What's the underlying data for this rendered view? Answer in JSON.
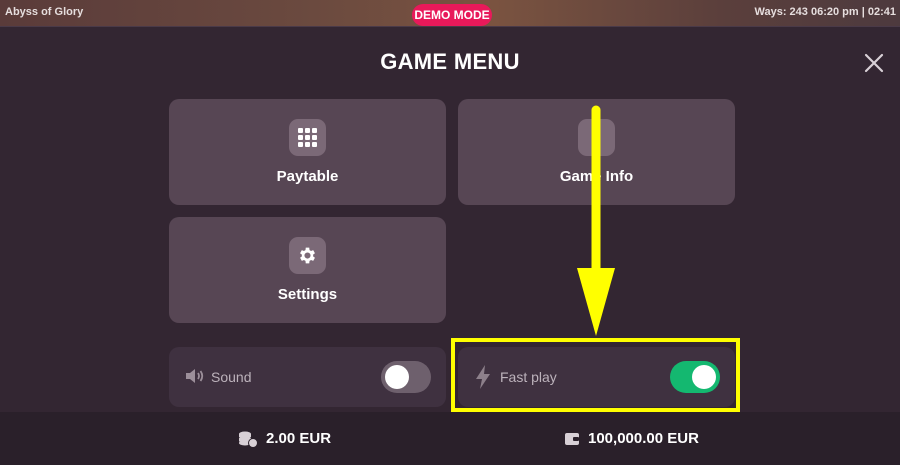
{
  "top": {
    "game_title": "Abyss of Glory",
    "demo_badge": "DEMO MODE",
    "status": "Ways: 243  06:20 pm | 02:41"
  },
  "menu": {
    "title": "GAME MENU",
    "close_icon": "close-icon",
    "tiles": [
      {
        "label": "Paytable",
        "icon": "grid-icon"
      },
      {
        "label": "Game Info",
        "icon": "info-icon"
      },
      {
        "label": "Settings",
        "icon": "gear-icon"
      }
    ],
    "toggles": [
      {
        "label": "Sound",
        "icon": "speaker-icon",
        "on": false
      },
      {
        "label": "Fast play",
        "icon": "lightning-icon",
        "on": true
      }
    ]
  },
  "bottom": {
    "bet": "2.00 EUR",
    "bet_icon": "coins-icon",
    "balance": "100,000.00 EUR",
    "balance_icon": "wallet-icon"
  },
  "colors": {
    "accent_demo": "#e8195a",
    "toggle_on": "#14b870",
    "highlight": "#ffff00"
  }
}
